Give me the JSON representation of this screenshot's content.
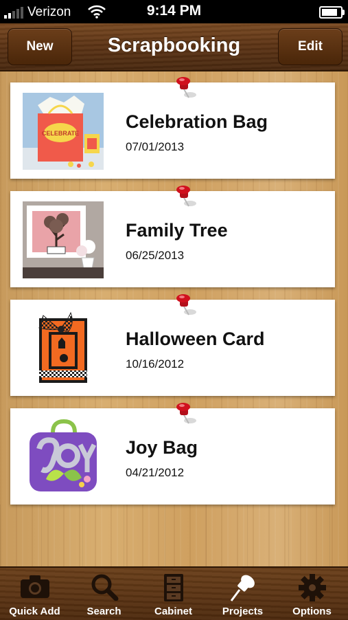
{
  "status_bar": {
    "carrier": "Verizon",
    "time": "9:14 PM"
  },
  "nav": {
    "new_label": "New",
    "title": "Scrapbooking",
    "edit_label": "Edit"
  },
  "projects": [
    {
      "name": "Celebration Bag",
      "date": "07/01/2013",
      "thumb_text": "CELEBRATE"
    },
    {
      "name": "Family Tree",
      "date": "06/25/2013"
    },
    {
      "name": "Halloween Card",
      "date": "10/16/2012"
    },
    {
      "name": "Joy Bag",
      "date": "04/21/2012"
    }
  ],
  "tabs": [
    {
      "label": "Quick Add",
      "icon": "camera-icon"
    },
    {
      "label": "Search",
      "icon": "search-icon"
    },
    {
      "label": "Cabinet",
      "icon": "cabinet-icon"
    },
    {
      "label": "Projects",
      "icon": "pushpin-icon",
      "selected": true
    },
    {
      "label": "Options",
      "icon": "gear-icon"
    }
  ],
  "colors": {
    "wood_light": "#d8ae70",
    "wood_dark": "#5e3516",
    "pin_red": "#d0101e"
  }
}
